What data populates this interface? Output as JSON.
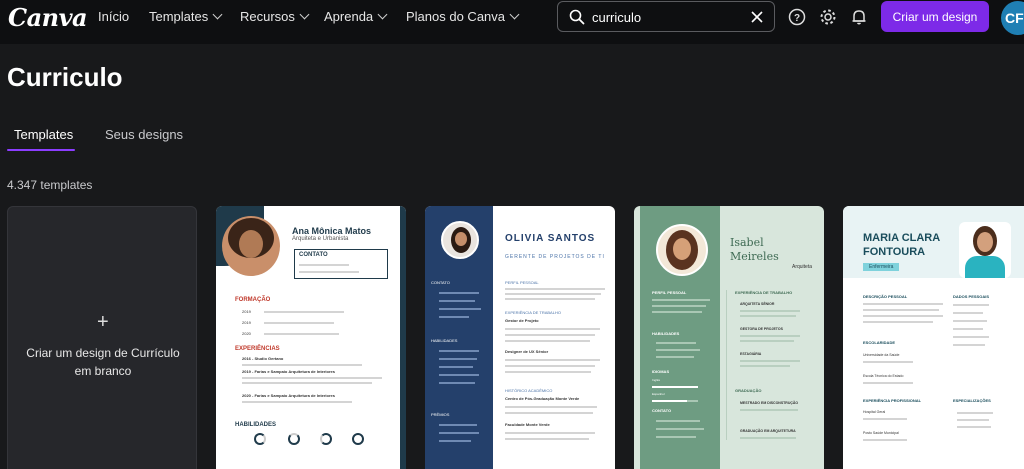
{
  "nav": {
    "logo": "Canva",
    "items": [
      "Início",
      "Templates",
      "Recursos",
      "Aprenda",
      "Planos do Canva"
    ],
    "create_label": "Criar um design",
    "avatar_initials": "CF",
    "accent": "#7d2ae8"
  },
  "search": {
    "value": "curriculo",
    "icon": "search-icon"
  },
  "page": {
    "title": "Curriculo",
    "count": "4.347 templates"
  },
  "tabs": [
    "Templates",
    "Seus designs"
  ],
  "blank_card": {
    "plus": "+",
    "label": "Criar um design de Currículo em branco"
  },
  "templates": [
    {
      "name": "Ana Mônica Matos",
      "role": "Arquiteta e Urbanista",
      "contact_heading": "CONTATO",
      "sections": [
        "FORMAÇÃO",
        "EXPERIÊNCIAS",
        "HABILIDADES"
      ],
      "years": [
        "2019",
        "2019",
        "2020"
      ],
      "exp": [
        "2016 - Studio Gertano",
        "2019 - Farias e Sampaio Arquitetura de Interiores",
        "2020 - Farias e Sampaio Arquitetura de Interiores"
      ]
    },
    {
      "name": "OLIVIA SANTOS",
      "role": "GERENTE DE PROJETOS DE TI",
      "sections": [
        "PERFIL PESSOAL",
        "EXPERIÊNCIA DE TRABALHO",
        "HISTÓRICO ACADÊMICO"
      ],
      "side": [
        "CONTATO",
        "HABILIDADES",
        "PRÊMIOS"
      ],
      "jobs": [
        "Gestor de Projeto",
        "Designer de UX Sênior",
        "Centro de Pós-Graduação Monte Verde",
        "Faculdade Monte Verde"
      ]
    },
    {
      "name_line1": "Isabel",
      "name_line2": "Meireles",
      "role": "Arquiteta",
      "side": [
        "PERFIL PESSOAL",
        "HABILIDADES",
        "IDIOMAS",
        "CONTATO"
      ],
      "sections": [
        "EXPERIÊNCIA DE TRABALHO",
        "GRADUAÇÃO"
      ],
      "jobs": [
        "ARQUITETA SÊNIOR",
        "GESTORA DE PROJETOS",
        "ESTAGIÁRIA",
        "MESTRADO EM DISCONSTRUÇÃO",
        "GRADUAÇÃO EM ARQUITETURA"
      ],
      "langs": [
        "Inglês",
        "Espanhol"
      ],
      "lang_values": [
        100,
        75
      ]
    },
    {
      "name_line1": "MARIA CLARA",
      "name_line2": "FONTOURA",
      "role": "Enfermeira",
      "sections": [
        "DESCRIÇÃO PESSOAL",
        "ESCOLARIDADE",
        "EXPERIÊNCIA PROFISSIONAL"
      ],
      "right": [
        "DADOS PESSOAIS",
        "ESPECIALIZAÇÕES"
      ],
      "schools": [
        "Universidade da Saúde",
        "Escola Técnica do Estado",
        "Hospital Geral",
        "Posto Saúde Municipal"
      ]
    }
  ]
}
